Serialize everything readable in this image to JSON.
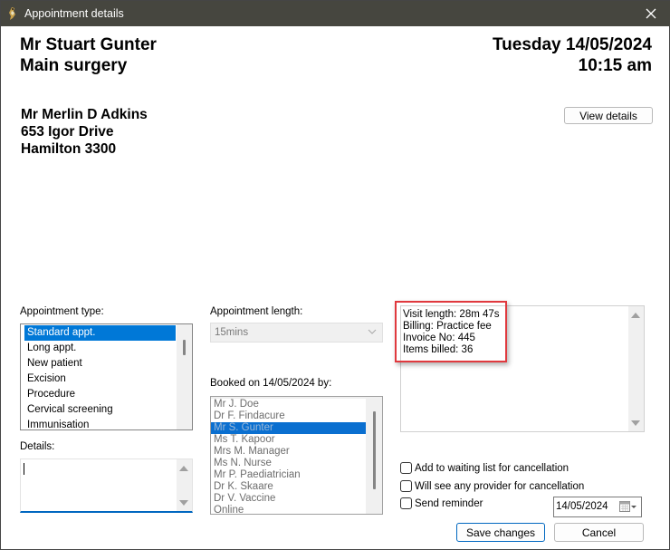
{
  "window": {
    "title": "Appointment details",
    "icons": {
      "app": "finch-bird-icon",
      "close": "close-icon"
    }
  },
  "header": {
    "provider_name": "Mr Stuart Gunter",
    "location": "Main surgery",
    "date": "Tuesday 14/05/2024",
    "time": "10:15 am"
  },
  "patient": {
    "name": "Mr Merlin D Adkins",
    "address_line1": "653 Igor Drive",
    "address_line2": "Hamilton  3300",
    "view_details_label": "View details"
  },
  "appointment_type": {
    "label": "Appointment type:",
    "items": [
      "Standard appt.",
      "Long appt.",
      "New patient",
      "Excision",
      "Procedure",
      "Cervical screening",
      "Immunisation"
    ],
    "selected": "Standard appt."
  },
  "appointment_length": {
    "label": "Appointment length:",
    "value": "15mins"
  },
  "booked_by": {
    "label": "Booked on 14/05/2024 by:",
    "items": [
      "Mr J. Doe",
      "Dr F. Findacure",
      "Mr S. Gunter",
      "Ms T. Kapoor",
      "Mrs M. Manager",
      "Ms N. Nurse",
      "Mr P. Paediatrician",
      "Dr K. Skaare",
      "Dr V. Vaccine",
      "Online"
    ],
    "selected": "Mr S. Gunter"
  },
  "details": {
    "label": "Details:",
    "value": ""
  },
  "visit_info": {
    "lines": [
      "Visit length: 28m  47s",
      "Billing: Practice fee",
      "Invoice No: 445",
      "Items billed: 36"
    ],
    "highlight_color": "#e0393e"
  },
  "options": {
    "waiting_list": {
      "label": "Add to waiting list for cancellation",
      "checked": false
    },
    "any_provider": {
      "label": "Will see any provider for cancellation",
      "checked": false
    },
    "send_reminder": {
      "label": "Send reminder",
      "checked": false
    },
    "reminder_date": "14/05/2024"
  },
  "actions": {
    "save_label": "Save changes",
    "cancel_label": "Cancel"
  },
  "colors": {
    "accent": "#0078d7",
    "titlebar": "#46463f"
  }
}
